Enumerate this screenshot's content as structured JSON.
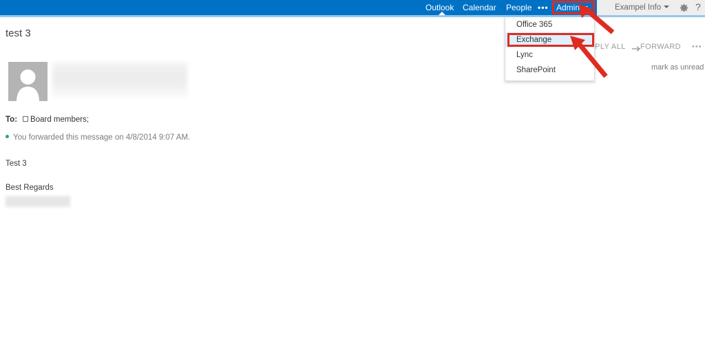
{
  "suite_bar": {
    "nav_items": [
      {
        "label": "Outlook",
        "active": true
      },
      {
        "label": "Calendar",
        "active": false
      },
      {
        "label": "People",
        "active": false
      },
      {
        "label": "•••",
        "active": false
      },
      {
        "label": "Admin",
        "active": false
      }
    ],
    "outlook_label": "Outlook",
    "calendar_label": "Calendar",
    "people_label": "People",
    "more_label": "•••",
    "admin_label": "Admin",
    "user_label": "Exampel Info",
    "gear_icon": "gear-icon",
    "help_label": "?",
    "background_color": "#0072c6",
    "right_background_color": "#eeeeee"
  },
  "admin_menu": {
    "items": [
      {
        "label": "Office 365",
        "selected": false
      },
      {
        "label": "Exchange",
        "selected": true
      },
      {
        "label": "Lync",
        "selected": false
      },
      {
        "label": "SharePoint",
        "selected": false
      }
    ],
    "item_0": "Office 365",
    "item_1": "Exchange",
    "item_2": "Lync",
    "item_3": "SharePoint",
    "selected_highlight_color": "#dfeffc"
  },
  "message": {
    "subject": "test 3",
    "avatar_icon": "person-avatar-icon",
    "to_label": "To:",
    "to_recipient": "Board members;",
    "forward_notice": "You forwarded this message on 4/8/2014 9:07 AM.",
    "body_line_1": "Test 3",
    "body_line_2": "Best Regards",
    "status_dot_color": "#2f9e8f"
  },
  "actions": {
    "reply_all_label": "REPLY ALL",
    "forward_label": "FORWARD",
    "forward_icon": "forward-arrow-icon",
    "more_label": "•••",
    "mark_unread_label": "mark as unread"
  },
  "annotations": {
    "admin_highlight": "red-rectangle-admin",
    "exchange_highlight": "red-rectangle-exchange",
    "arrow_color": "#e02b20"
  }
}
